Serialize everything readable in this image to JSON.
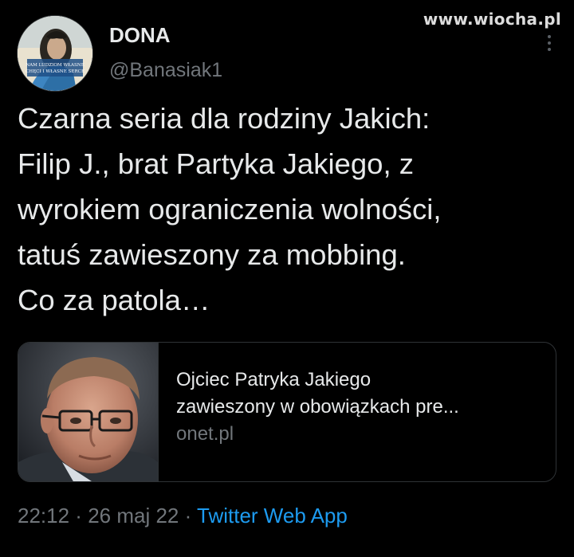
{
  "watermark": "www.wiocha.pl",
  "user": {
    "display_name": "DONA",
    "handle": "@Banasiak1",
    "avatar_text": "NAM LUDZIOM WŁASNE CHĘCI I WŁASNE SERCE",
    "avatar_icon": "profile-avatar-image"
  },
  "tweet": {
    "text": "Czarna seria dla rodziny Jakich:\nFilip J., brat Partyka Jakiego, z\nwyrokiem ograniczenia wolności,\ntatuś zawieszony za mobbing.\nCo za patola…"
  },
  "link_card": {
    "title": "Ojciec Patryka Jakiego\nzawieszony w obowiązkach pre...",
    "domain": "onet.pl",
    "thumbnail_icon": "man-with-glasses-photo"
  },
  "meta": {
    "time": "22:12",
    "separator1": " · ",
    "date": "26 maj 22",
    "separator2": " · ",
    "app": "Twitter Web App"
  },
  "colors": {
    "background": "#000000",
    "text": "#e7e9ea",
    "secondary": "#71767b",
    "accent": "#1d9bf0",
    "border": "#2f3336"
  }
}
